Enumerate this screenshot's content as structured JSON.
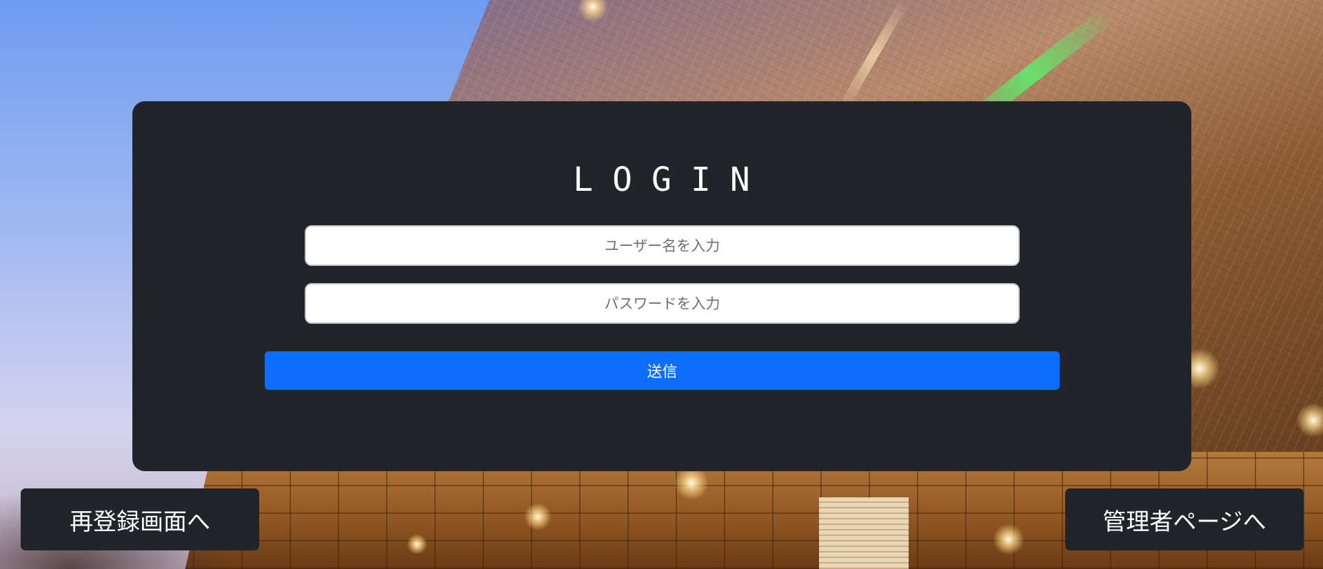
{
  "login": {
    "title": "LOGIN",
    "username_placeholder": "ユーザー名を入力",
    "password_placeholder": "パスワードを入力",
    "submit_label": "送信"
  },
  "footer": {
    "reregister_label": "再登録画面へ",
    "admin_label": "管理者ページへ"
  },
  "colors": {
    "panel_bg": "#212529",
    "primary_button": "#0d6efd",
    "text": "#ffffff"
  }
}
